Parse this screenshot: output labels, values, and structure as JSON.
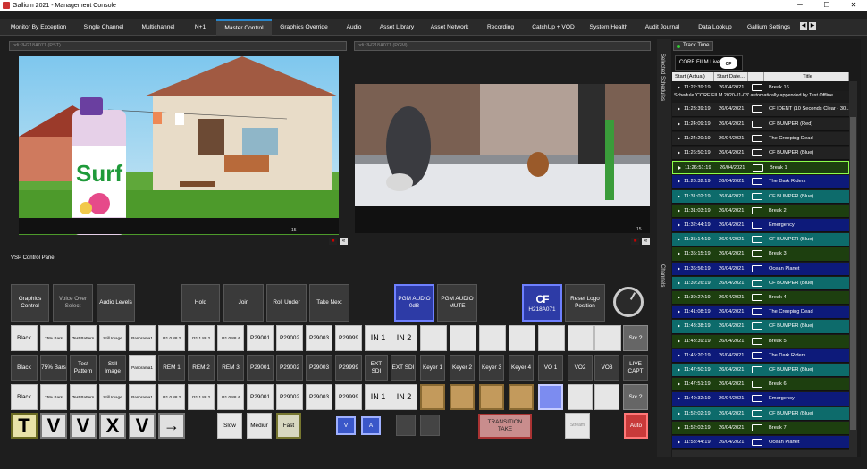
{
  "window": {
    "title": "Gallium 2021 - Management Console"
  },
  "tabs": [
    "Monitor By Exception",
    "Single Channel",
    "Multichannel",
    "N+1",
    "Master Control",
    "Graphics Override",
    "Audio",
    "Asset Library",
    "Asset Network",
    "Recording",
    "CatchUp + VOD",
    "System Health",
    "Audit Journal",
    "Data Lookup",
    "Gallium Settings"
  ],
  "active_tab": "Master Control",
  "preview": {
    "source": "ndi://H218A071 (PST)",
    "counter": "15"
  },
  "program": {
    "source": "ndi://H218A071 (PGM)",
    "counter": "15"
  },
  "panel_title": "VSP Control Panel",
  "top_buttons": {
    "graphics_control": "Graphics Control",
    "voice_over_select": "Voice Over Select",
    "audio_levels": "Audio Levels",
    "hold": "Hold",
    "join": "Join",
    "roll_under": "Roll Under",
    "take_next": "Take Next",
    "pgm_audio": "PGM AUDIO 0dB",
    "pgm_audio_mute": "PGM AUDIO MUTE",
    "channel_logo": "CF",
    "channel_id": "H218A071",
    "reset_logo": "Reset Logo Position"
  },
  "row1": [
    "Black",
    "75% Bars",
    "Test Pattern",
    "Still Image",
    "Panorama1",
    "I31.0.88.2",
    "I31.1.88.2",
    "I31.0.88.4",
    "P29001",
    "P29002",
    "P29003",
    "P29999",
    "IN 1",
    "IN 2"
  ],
  "row1_src": "Src ?",
  "row2": [
    "Black",
    "75% Bars",
    "Test Pattern",
    "Still Image",
    "Panorama1",
    "REM 1",
    "REM 2",
    "REM 3",
    "P29001",
    "P29002",
    "P29003",
    "P29999",
    "EXT SDI",
    "EXT SDI"
  ],
  "row2_keyers": [
    "Keyer 1",
    "Keyer 2",
    "Keyer 3",
    "Keyer 4",
    "VO 1",
    "VO2",
    "VO3",
    "LIVE CAPT"
  ],
  "row3": [
    "Black",
    "75% Bars",
    "Test Pattern",
    "Still Image",
    "Panorama1",
    "I31.0.88.2",
    "I31.1.88.2",
    "I31.0.88.4",
    "P29001",
    "P29002",
    "P29003",
    "P29999",
    "IN 1",
    "IN 2"
  ],
  "row3_src": "Src ?",
  "transitions": {
    "slow": "Slow",
    "medium": "Mediur",
    "fast": "Fast",
    "v": "V",
    "a": "A",
    "take": "TRANSITION TAKE",
    "stream": "Stream",
    "auto": "Auto"
  },
  "wipes": [
    "T",
    "V",
    "V",
    "X",
    "V",
    "→"
  ],
  "sidebar": {
    "selected_schedules": "Selected Schedules",
    "channels": "Channels"
  },
  "schedule": {
    "track_time": "Track Time",
    "channel": "CORE FILM.Live",
    "channel_logo": "CF",
    "columns": [
      "Start (Actual)",
      "Start Date...",
      "",
      "Title"
    ],
    "message": "Schedule 'CORE FILM 2020-11-03' automatically appended by Test Offline",
    "rows": [
      {
        "start": "11:22:39:19",
        "date": "26/04/2021",
        "title": "Break 16",
        "color": "#1a1a1a"
      },
      {
        "start": "11:23:39:19",
        "date": "26/04/2021",
        "title": "CF IDENT (10 Seconds Clear - 30...",
        "color": "#222"
      },
      {
        "start": "11:24:09:19",
        "date": "26/04/2021",
        "title": "CF BUMPER (Red)",
        "color": "#222"
      },
      {
        "start": "11:24:20:19",
        "date": "26/04/2021",
        "title": "The Creeping Dead",
        "color": "#222"
      },
      {
        "start": "11:26:50:19",
        "date": "26/04/2021",
        "title": "CF BUMPER (Blue)",
        "color": "#222"
      },
      {
        "start": "11:26:51:19",
        "date": "26/04/2021",
        "title": "Break 1",
        "color": "#1d3f0f"
      },
      {
        "start": "11:28:32:19",
        "date": "26/04/2021",
        "title": "The Dark Riders",
        "color": "#0d1a7a"
      },
      {
        "start": "11:31:02:19",
        "date": "26/04/2021",
        "title": "CF BUMPER (Blue)",
        "color": "#0d6b6b"
      },
      {
        "start": "11:31:03:19",
        "date": "26/04/2021",
        "title": "Break 2",
        "color": "#1d3f0f"
      },
      {
        "start": "11:32:44:19",
        "date": "26/04/2021",
        "title": "Emergency",
        "color": "#0d1a7a"
      },
      {
        "start": "11:35:14:19",
        "date": "26/04/2021",
        "title": "CF BUMPER (Blue)",
        "color": "#0d6b6b"
      },
      {
        "start": "11:35:15:19",
        "date": "26/04/2021",
        "title": "Break 3",
        "color": "#1d3f0f"
      },
      {
        "start": "11:36:56:19",
        "date": "26/04/2021",
        "title": "Ocean Planet",
        "color": "#0d1a7a"
      },
      {
        "start": "11:39:26:19",
        "date": "26/04/2021",
        "title": "CF BUMPER (Blue)",
        "color": "#0d6b6b"
      },
      {
        "start": "11:39:27:19",
        "date": "26/04/2021",
        "title": "Break 4",
        "color": "#1d3f0f"
      },
      {
        "start": "11:41:08:19",
        "date": "26/04/2021",
        "title": "The Creeping Dead",
        "color": "#0d1a7a"
      },
      {
        "start": "11:43:38:19",
        "date": "26/04/2021",
        "title": "CF BUMPER (Blue)",
        "color": "#0d6b6b"
      },
      {
        "start": "11:43:39:19",
        "date": "26/04/2021",
        "title": "Break 5",
        "color": "#1d3f0f"
      },
      {
        "start": "11:45:20:19",
        "date": "26/04/2021",
        "title": "The Dark Riders",
        "color": "#0d1a7a"
      },
      {
        "start": "11:47:50:19",
        "date": "26/04/2021",
        "title": "CF BUMPER (Blue)",
        "color": "#0d6b6b"
      },
      {
        "start": "11:47:51:19",
        "date": "26/04/2021",
        "title": "Break 6",
        "color": "#1d3f0f"
      },
      {
        "start": "11:49:32:19",
        "date": "26/04/2021",
        "title": "Emergency",
        "color": "#0d1a7a"
      },
      {
        "start": "11:52:02:19",
        "date": "26/04/2021",
        "title": "CF BUMPER (Blue)",
        "color": "#0d6b6b"
      },
      {
        "start": "11:52:03:19",
        "date": "26/04/2021",
        "title": "Break 7",
        "color": "#1d3f0f"
      },
      {
        "start": "11:53:44:19",
        "date": "26/04/2021",
        "title": "Ocean Planet",
        "color": "#0d1a7a"
      }
    ]
  }
}
